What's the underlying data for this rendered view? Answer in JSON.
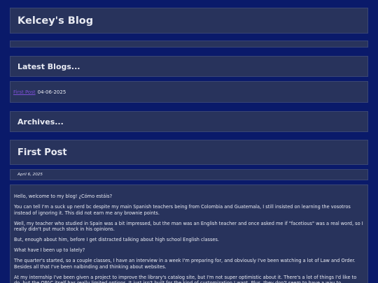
{
  "site": {
    "title": "Kelcey's Blog"
  },
  "latest": {
    "heading": "Latest Blogs...",
    "items": [
      {
        "link": "First Post",
        "date": "04-06-2025"
      }
    ]
  },
  "archives": {
    "heading": "Archives..."
  },
  "post": {
    "title": "First Post",
    "date": "April 6, 2025",
    "paragraphs": [
      "Hello, welcome to my blog! ¿Cómo estáis?",
      "You can tell I'm a suck up nerd bc despite my main Spanish teachers being from Colombia and Guatemala, I still insisted on learning the vosotros instead of ignoring it. This did not earn me any brownie points.",
      "Well, my teacher who studied in Spain was a bit impressed, but the man was an English teacher and once asked me if \"facetious\" was a real word, so I really didn't put much stock in his opinions.",
      "But, enough about him, before I get distracted talking about high school English classes.",
      "What have I been up to lately?",
      "The quarter's started, so a couple classes, I have an interview in a week I'm preparing for, and obviously I've been watching a lot of Law and Order. Besides all that I've been nalbinding and thinking about websites.",
      "At my internship I've been given a project to improve the library's catalog site, but I'm not super optimistic about it. There's a lot of things I'd like to do, but the OPAC itself has really limited options. It just isn't built for the kind of customization I want. Plus, they don't seem to have a way to"
    ]
  }
}
